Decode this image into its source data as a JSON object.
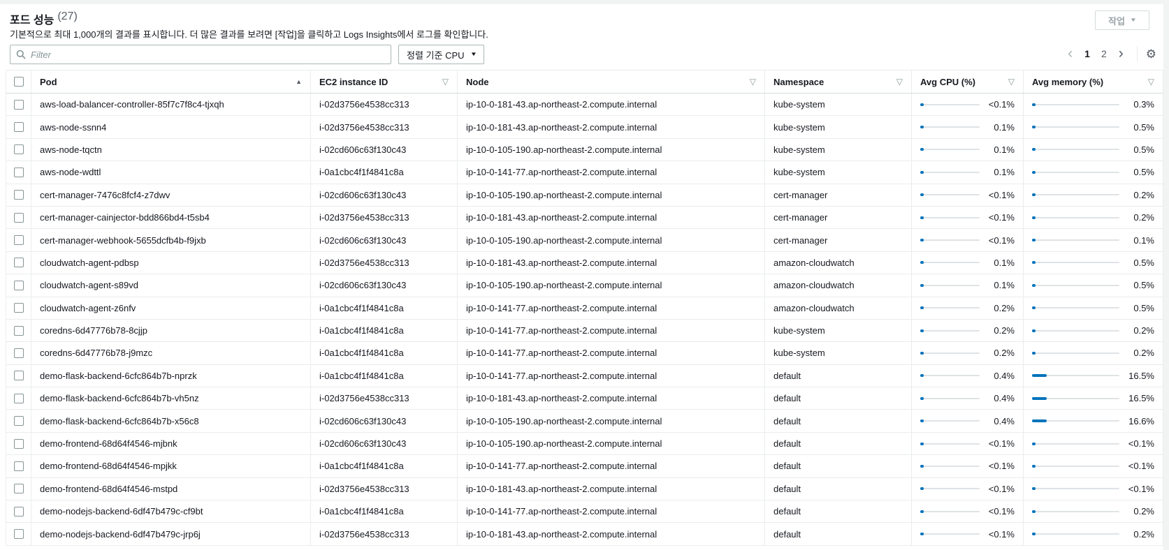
{
  "header": {
    "title": "포드 성능",
    "count": "(27)",
    "description": "기본적으로 최대 1,000개의 결과를 표시합니다. 더 많은 결과를 보려면 [작업]을 클릭하고 Logs Insights에서 로그를 확인합니다.",
    "actions_button": "작업"
  },
  "toolbar": {
    "filter_placeholder": "Filter",
    "sort_button": "정렬 기준 CPU",
    "pagination": {
      "pages": [
        "1",
        "2"
      ],
      "current": "1"
    }
  },
  "colors": {
    "accent": "#0073bb",
    "bar_track": "#dfe3e6"
  },
  "table": {
    "columns": {
      "pod": "Pod",
      "ec2": "EC2 instance ID",
      "node": "Node",
      "namespace": "Namespace",
      "cpu": "Avg CPU (%)",
      "memory": "Avg memory (%)"
    },
    "sorted_column": "Pod",
    "sort_direction": "ascending",
    "rows": [
      {
        "pod": "aws-load-balancer-controller-85f7c7f8c4-tjxqh",
        "instance": "i-02d3756e4538cc313",
        "node": "ip-10-0-181-43.ap-northeast-2.compute.internal",
        "namespace": "kube-system",
        "cpu": {
          "label": "<0.1%",
          "value": 0.05
        },
        "memory": {
          "label": "0.3%",
          "value": 0.3
        }
      },
      {
        "pod": "aws-node-ssnn4",
        "instance": "i-02d3756e4538cc313",
        "node": "ip-10-0-181-43.ap-northeast-2.compute.internal",
        "namespace": "kube-system",
        "cpu": {
          "label": "0.1%",
          "value": 0.1
        },
        "memory": {
          "label": "0.5%",
          "value": 0.5
        }
      },
      {
        "pod": "aws-node-tqctn",
        "instance": "i-02cd606c63f130c43",
        "node": "ip-10-0-105-190.ap-northeast-2.compute.internal",
        "namespace": "kube-system",
        "cpu": {
          "label": "0.1%",
          "value": 0.1
        },
        "memory": {
          "label": "0.5%",
          "value": 0.5
        }
      },
      {
        "pod": "aws-node-wdttl",
        "instance": "i-0a1cbc4f1f4841c8a",
        "node": "ip-10-0-141-77.ap-northeast-2.compute.internal",
        "namespace": "kube-system",
        "cpu": {
          "label": "0.1%",
          "value": 0.1
        },
        "memory": {
          "label": "0.5%",
          "value": 0.5
        }
      },
      {
        "pod": "cert-manager-7476c8fcf4-z7dwv",
        "instance": "i-02cd606c63f130c43",
        "node": "ip-10-0-105-190.ap-northeast-2.compute.internal",
        "namespace": "cert-manager",
        "cpu": {
          "label": "<0.1%",
          "value": 0.05
        },
        "memory": {
          "label": "0.2%",
          "value": 0.2
        }
      },
      {
        "pod": "cert-manager-cainjector-bdd866bd4-t5sb4",
        "instance": "i-02d3756e4538cc313",
        "node": "ip-10-0-181-43.ap-northeast-2.compute.internal",
        "namespace": "cert-manager",
        "cpu": {
          "label": "<0.1%",
          "value": 0.05
        },
        "memory": {
          "label": "0.2%",
          "value": 0.2
        }
      },
      {
        "pod": "cert-manager-webhook-5655dcfb4b-f9jxb",
        "instance": "i-02cd606c63f130c43",
        "node": "ip-10-0-105-190.ap-northeast-2.compute.internal",
        "namespace": "cert-manager",
        "cpu": {
          "label": "<0.1%",
          "value": 0.05
        },
        "memory": {
          "label": "0.1%",
          "value": 0.1
        }
      },
      {
        "pod": "cloudwatch-agent-pdbsp",
        "instance": "i-02d3756e4538cc313",
        "node": "ip-10-0-181-43.ap-northeast-2.compute.internal",
        "namespace": "amazon-cloudwatch",
        "cpu": {
          "label": "0.1%",
          "value": 0.1
        },
        "memory": {
          "label": "0.5%",
          "value": 0.5
        }
      },
      {
        "pod": "cloudwatch-agent-s89vd",
        "instance": "i-02cd606c63f130c43",
        "node": "ip-10-0-105-190.ap-northeast-2.compute.internal",
        "namespace": "amazon-cloudwatch",
        "cpu": {
          "label": "0.1%",
          "value": 0.1
        },
        "memory": {
          "label": "0.5%",
          "value": 0.5
        }
      },
      {
        "pod": "cloudwatch-agent-z6nfv",
        "instance": "i-0a1cbc4f1f4841c8a",
        "node": "ip-10-0-141-77.ap-northeast-2.compute.internal",
        "namespace": "amazon-cloudwatch",
        "cpu": {
          "label": "0.2%",
          "value": 0.2
        },
        "memory": {
          "label": "0.5%",
          "value": 0.5
        }
      },
      {
        "pod": "coredns-6d47776b78-8cjjp",
        "instance": "i-0a1cbc4f1f4841c8a",
        "node": "ip-10-0-141-77.ap-northeast-2.compute.internal",
        "namespace": "kube-system",
        "cpu": {
          "label": "0.2%",
          "value": 0.2
        },
        "memory": {
          "label": "0.2%",
          "value": 0.2
        }
      },
      {
        "pod": "coredns-6d47776b78-j9mzc",
        "instance": "i-0a1cbc4f1f4841c8a",
        "node": "ip-10-0-141-77.ap-northeast-2.compute.internal",
        "namespace": "kube-system",
        "cpu": {
          "label": "0.2%",
          "value": 0.2
        },
        "memory": {
          "label": "0.2%",
          "value": 0.2
        }
      },
      {
        "pod": "demo-flask-backend-6cfc864b7b-nprzk",
        "instance": "i-0a1cbc4f1f4841c8a",
        "node": "ip-10-0-141-77.ap-northeast-2.compute.internal",
        "namespace": "default",
        "cpu": {
          "label": "0.4%",
          "value": 0.4
        },
        "memory": {
          "label": "16.5%",
          "value": 16.5
        }
      },
      {
        "pod": "demo-flask-backend-6cfc864b7b-vh5nz",
        "instance": "i-02d3756e4538cc313",
        "node": "ip-10-0-181-43.ap-northeast-2.compute.internal",
        "namespace": "default",
        "cpu": {
          "label": "0.4%",
          "value": 0.4
        },
        "memory": {
          "label": "16.5%",
          "value": 16.5
        }
      },
      {
        "pod": "demo-flask-backend-6cfc864b7b-x56c8",
        "instance": "i-02cd606c63f130c43",
        "node": "ip-10-0-105-190.ap-northeast-2.compute.internal",
        "namespace": "default",
        "cpu": {
          "label": "0.4%",
          "value": 0.4
        },
        "memory": {
          "label": "16.6%",
          "value": 16.6
        }
      },
      {
        "pod": "demo-frontend-68d64f4546-mjbnk",
        "instance": "i-02cd606c63f130c43",
        "node": "ip-10-0-105-190.ap-northeast-2.compute.internal",
        "namespace": "default",
        "cpu": {
          "label": "<0.1%",
          "value": 0.05
        },
        "memory": {
          "label": "<0.1%",
          "value": 0.05
        }
      },
      {
        "pod": "demo-frontend-68d64f4546-mpjkk",
        "instance": "i-0a1cbc4f1f4841c8a",
        "node": "ip-10-0-141-77.ap-northeast-2.compute.internal",
        "namespace": "default",
        "cpu": {
          "label": "<0.1%",
          "value": 0.05
        },
        "memory": {
          "label": "<0.1%",
          "value": 0.05
        }
      },
      {
        "pod": "demo-frontend-68d64f4546-mstpd",
        "instance": "i-02d3756e4538cc313",
        "node": "ip-10-0-181-43.ap-northeast-2.compute.internal",
        "namespace": "default",
        "cpu": {
          "label": "<0.1%",
          "value": 0.05
        },
        "memory": {
          "label": "<0.1%",
          "value": 0.05
        }
      },
      {
        "pod": "demo-nodejs-backend-6df47b479c-cf9bt",
        "instance": "i-0a1cbc4f1f4841c8a",
        "node": "ip-10-0-141-77.ap-northeast-2.compute.internal",
        "namespace": "default",
        "cpu": {
          "label": "<0.1%",
          "value": 0.05
        },
        "memory": {
          "label": "0.2%",
          "value": 0.2
        }
      },
      {
        "pod": "demo-nodejs-backend-6df47b479c-jrp6j",
        "instance": "i-02d3756e4538cc313",
        "node": "ip-10-0-181-43.ap-northeast-2.compute.internal",
        "namespace": "default",
        "cpu": {
          "label": "<0.1%",
          "value": 0.05
        },
        "memory": {
          "label": "0.2%",
          "value": 0.2
        }
      }
    ]
  }
}
